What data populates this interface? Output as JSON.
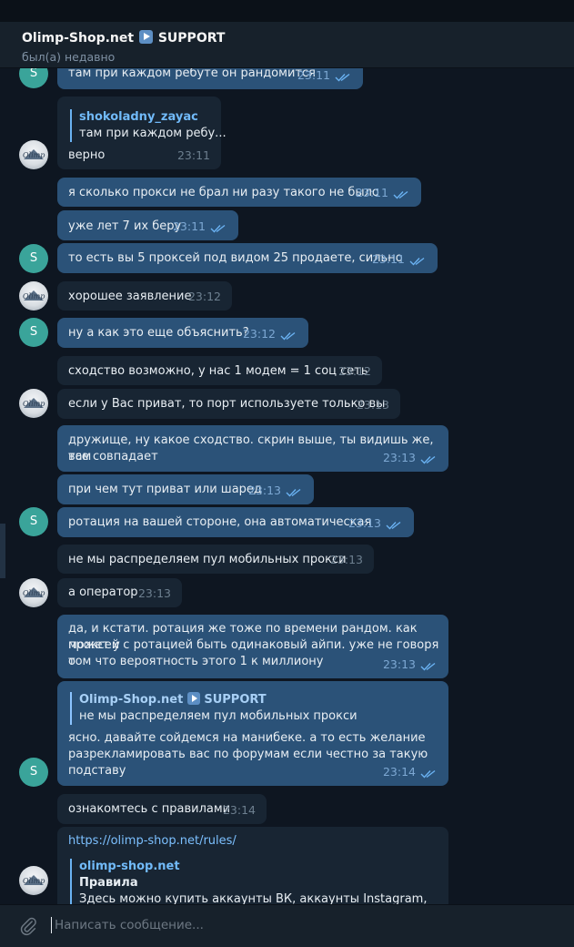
{
  "header": {
    "title_before": "Olimp-Shop.net",
    "title_after": "SUPPORT",
    "status": "был(а) недавно"
  },
  "messages": [
    {
      "text": "там при каждом ребуте он рандомится",
      "time": "23:11"
    },
    {
      "reply_name": "shokoladny_zayac",
      "reply_text": "там при каждом ребу...",
      "text": "верно",
      "time": "23:11"
    },
    {
      "text": "я сколько прокси не брал ни разу такого не было",
      "time": "23:11"
    },
    {
      "text": "уже лет 7 их беру",
      "time": "23:11"
    },
    {
      "text": "то есть вы 5 проксей под видом 25 продаете, сильно",
      "time": "23:11"
    },
    {
      "text": "хорошее заявление",
      "time": "23:12"
    },
    {
      "text": "ну а как это еще объяснить?",
      "time": "23:12"
    },
    {
      "text": "сходство возможно, у нас 1 модем = 1 соц сеть",
      "time": "23:12"
    },
    {
      "text": "если у Вас приват, то порт используете только вы",
      "time": "23:13"
    },
    {
      "line1": "дружище, ну какое сходство. скрин выше, ты видишь же, там",
      "line2": "все совпадает",
      "time": "23:13"
    },
    {
      "text": "при чем тут приват или шаред",
      "time": "23:13"
    },
    {
      "text": "ротация на вашей стороне, она автоматическая",
      "time": "23:13"
    },
    {
      "text": "не мы распределяем пул мобильных прокси",
      "time": "23:13"
    },
    {
      "text": "а оператор",
      "time": "23:13"
    },
    {
      "line1": "да, и кстати. ротация же тоже по времени рандом. как может у",
      "line2": "проксей с ротацией быть одинаковый айпи. уже не говоря о",
      "line3": "том что вероятность этого 1 к миллиону",
      "time": "23:13"
    },
    {
      "reply_name_before": "Olimp-Shop.net",
      "reply_name_after": "SUPPORT",
      "reply_text": "не мы распределяем пул мобильных прокси",
      "line1": "ясно. давайте сойдемся на манибеке. а то есть желание",
      "line2": "разрекламировать вас по форумам если честно за такую",
      "line3": "подставу",
      "time": "23:14"
    },
    {
      "text": "ознакомтесь с правилами",
      "time": "23:14"
    },
    {
      "link": "https://olimp-shop.net/rules/",
      "preview_site": "olimp-shop.net",
      "preview_title": "Правила",
      "preview_text": "Здесь можно купить аккаунты ВК, аккаунты Instagram,"
    }
  ],
  "avatars": {
    "user_letter": "S",
    "support_label": "Olimp"
  },
  "composer": {
    "placeholder": "Написать сообщение..."
  },
  "icons": {
    "check": "double-check-icon",
    "attach": "paperclip-icon",
    "play": "play-button-icon"
  },
  "colors": {
    "outgoing": "#2b5278",
    "incoming": "#182533",
    "accent": "#6ab2f2",
    "user_avatar": "#3aa49a"
  }
}
